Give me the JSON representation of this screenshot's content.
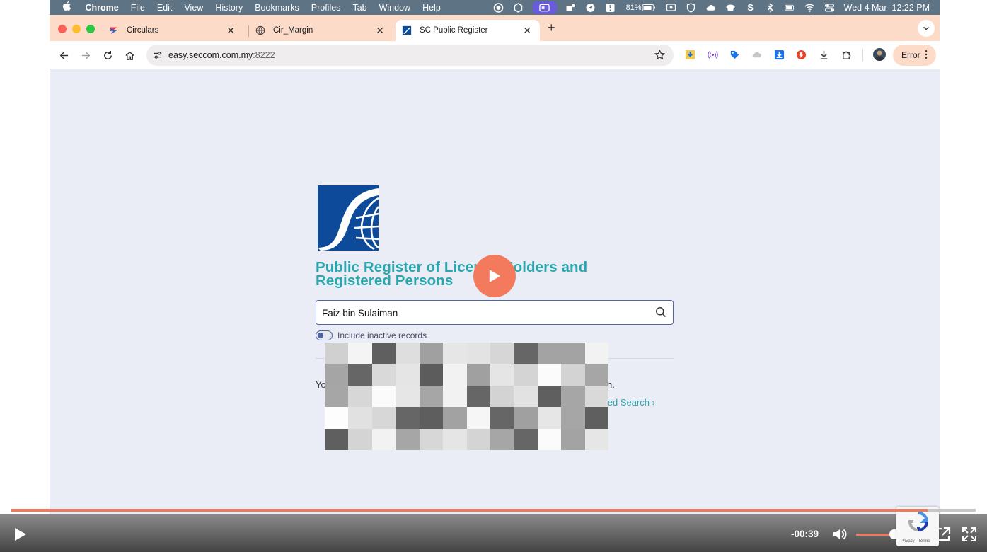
{
  "menubar": {
    "app": "Chrome",
    "items": [
      "File",
      "Edit",
      "View",
      "History",
      "Bookmarks",
      "Profiles",
      "Tab",
      "Window",
      "Help"
    ],
    "battery": "81%",
    "clock": "Wed 4 Mar  12:22 PM"
  },
  "tabs": [
    {
      "title": "Circulars",
      "icon": "circulars-favicon",
      "active": false
    },
    {
      "title": "Cir_Margin",
      "icon": "globe-icon",
      "active": false
    },
    {
      "title": "SC Public Register",
      "icon": "sc-favicon",
      "active": true
    }
  ],
  "omnibox": {
    "host": "easy.seccom.com.my",
    "port": ":8222"
  },
  "profile": {
    "error_label": "Error"
  },
  "page": {
    "heading_line1": "Public Register of Licence Holders and",
    "heading_line2": "Registered Persons",
    "search_value": "Faiz bin Sulaiman",
    "toggle_label": "Include inactive records",
    "fragment_left": "Yo",
    "fragment_right": "h.",
    "advanced_link": "nced Search  ›"
  },
  "video": {
    "remaining": "-00:39",
    "progress": 0.95,
    "volume": 0.85
  },
  "recaptcha": {
    "label": "Privacy - Terms"
  },
  "colors": {
    "accent": "#f1785b",
    "heading": "#2aa7ae",
    "brand_blue": "#0d4b9a",
    "tab_strip": "#fcdcc8",
    "page_bg": "#ebedf6"
  }
}
